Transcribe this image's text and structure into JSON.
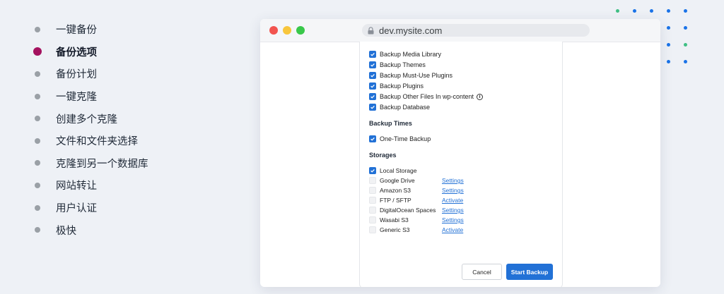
{
  "features": [
    {
      "label": "一键备份",
      "active": false
    },
    {
      "label": "备份选项",
      "active": true
    },
    {
      "label": "备份计划",
      "active": false
    },
    {
      "label": "一键克隆",
      "active": false
    },
    {
      "label": "创建多个克隆",
      "active": false
    },
    {
      "label": "文件和文件夹选择",
      "active": false
    },
    {
      "label": "克隆到另一个数据库",
      "active": false
    },
    {
      "label": "网站转让",
      "active": false
    },
    {
      "label": "用户认证",
      "active": false
    },
    {
      "label": "极快",
      "active": false
    }
  ],
  "browser": {
    "url": "dev.mysite.com"
  },
  "backup_options": [
    {
      "label": "Backup Media Library",
      "checked": true
    },
    {
      "label": "Backup Themes",
      "checked": true
    },
    {
      "label": "Backup Must-Use Plugins",
      "checked": true
    },
    {
      "label": "Backup Plugins",
      "checked": true
    },
    {
      "label": "Backup Other Files In wp-content",
      "checked": true,
      "info_icon": true
    },
    {
      "label": "Backup Database",
      "checked": true
    }
  ],
  "backup_times": {
    "title": "Backup Times",
    "options": [
      {
        "label": "One-Time Backup",
        "checked": true
      }
    ]
  },
  "storages": {
    "title": "Storages",
    "items": [
      {
        "label": "Local Storage",
        "checked": true,
        "link": ""
      },
      {
        "label": "Google Drive",
        "checked": false,
        "link": "Settings"
      },
      {
        "label": "Amazon S3",
        "checked": false,
        "link": "Settings"
      },
      {
        "label": "FTP / SFTP",
        "checked": false,
        "link": "Activate"
      },
      {
        "label": "DigitalOcean Spaces",
        "checked": false,
        "link": "Settings"
      },
      {
        "label": "Wasabi S3",
        "checked": false,
        "link": "Settings"
      },
      {
        "label": "Generic S3",
        "checked": false,
        "link": "Activate"
      }
    ]
  },
  "buttons": {
    "cancel": "Cancel",
    "start": "Start Backup"
  },
  "colors": {
    "accent": "#2271d6",
    "active_bullet": "#a4125f",
    "dot_blue": "#1a73e8",
    "dot_green": "#3fbf84"
  },
  "icons": {
    "lock": "lock-icon",
    "info": "info-icon",
    "check": "checkmark-icon"
  }
}
